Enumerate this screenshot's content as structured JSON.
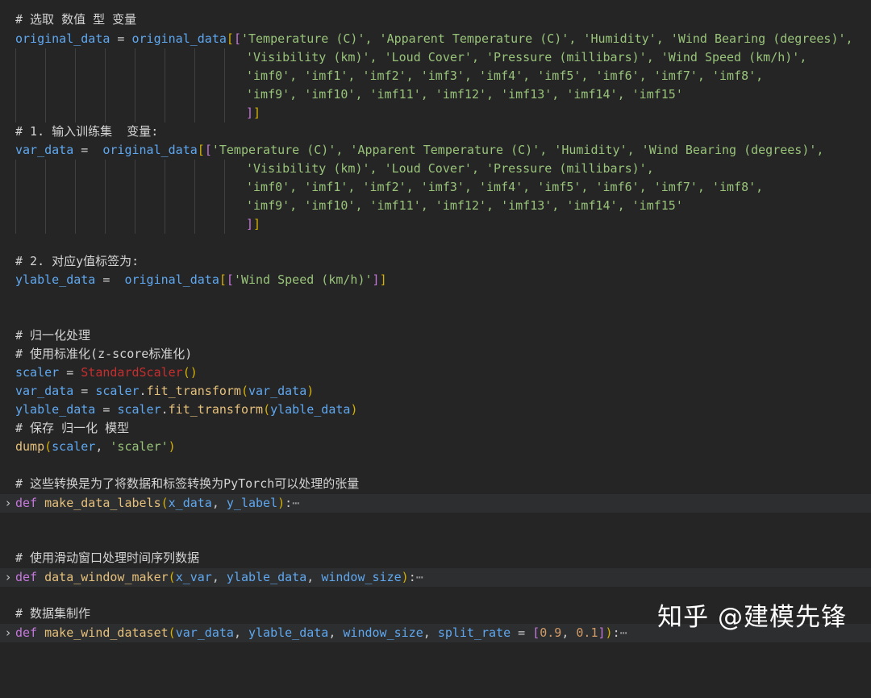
{
  "code": {
    "c1": "# 选取 数值 型 变量",
    "l_orig": {
      "name": "original_data",
      "src": "original_data",
      "row1": "'Temperature (C)', 'Apparent Temperature (C)', 'Humidity', 'Wind Bearing (degrees)',",
      "row2": "'Visibility (km)', 'Loud Cover', 'Pressure (millibars)', 'Wind Speed (km/h)',",
      "row3": "'imf0', 'imf1', 'imf2', 'imf3', 'imf4', 'imf5', 'imf6', 'imf7', 'imf8',",
      "row4": "'imf9', 'imf10', 'imf11', 'imf12', 'imf13', 'imf14', 'imf15'"
    },
    "c2": "# 1. 输入训练集  变量:",
    "l_var": {
      "name": "var_data",
      "src": "original_data",
      "row1": "'Temperature (C)', 'Apparent Temperature (C)', 'Humidity', 'Wind Bearing (degrees)',",
      "row2": "'Visibility (km)', 'Loud Cover', 'Pressure (millibars)',",
      "row3": "'imf0', 'imf1', 'imf2', 'imf3', 'imf4', 'imf5', 'imf6', 'imf7', 'imf8',",
      "row4": "'imf9', 'imf10', 'imf11', 'imf12', 'imf13', 'imf14', 'imf15'"
    },
    "c3": "# 2. 对应y值标签为:",
    "l_ylable": {
      "name": "ylable_data",
      "src": "original_data",
      "str": "'Wind Speed (km/h)'"
    },
    "c4": "# 归一化处理",
    "c5": "# 使用标准化(z-score标准化)",
    "l_scaler": {
      "name": "scaler",
      "cls": "StandardScaler"
    },
    "l_fit1": {
      "name": "var_data",
      "obj": "scaler",
      "method": "fit_transform",
      "arg": "var_data"
    },
    "l_fit2": {
      "name": "ylable_data",
      "obj": "scaler",
      "method": "fit_transform",
      "arg": "ylable_data"
    },
    "c6": "# 保存 归一化 模型",
    "l_dump": {
      "fn": "dump",
      "arg1": "scaler",
      "arg2": "'scaler'"
    },
    "c7": "# 这些转换是为了将数据和标签转换为PyTorch可以处理的张量",
    "def1": {
      "kw": "def",
      "name": "make_data_labels",
      "params": [
        "x_data",
        "y_label"
      ]
    },
    "c8": "# 使用滑动窗口处理时间序列数据",
    "def2": {
      "kw": "def",
      "name": "data_window_maker",
      "params": [
        "x_var",
        "ylable_data",
        "window_size"
      ]
    },
    "c9": "# 数据集制作",
    "def3": {
      "kw": "def",
      "name": "make_wind_dataset",
      "params": [
        "var_data",
        "ylable_data",
        "window_size",
        "split_rate"
      ],
      "default1": "0.9",
      "default2": "0.1"
    },
    "ellipsis": "⋯"
  },
  "watermark": "知乎 @建模先锋"
}
